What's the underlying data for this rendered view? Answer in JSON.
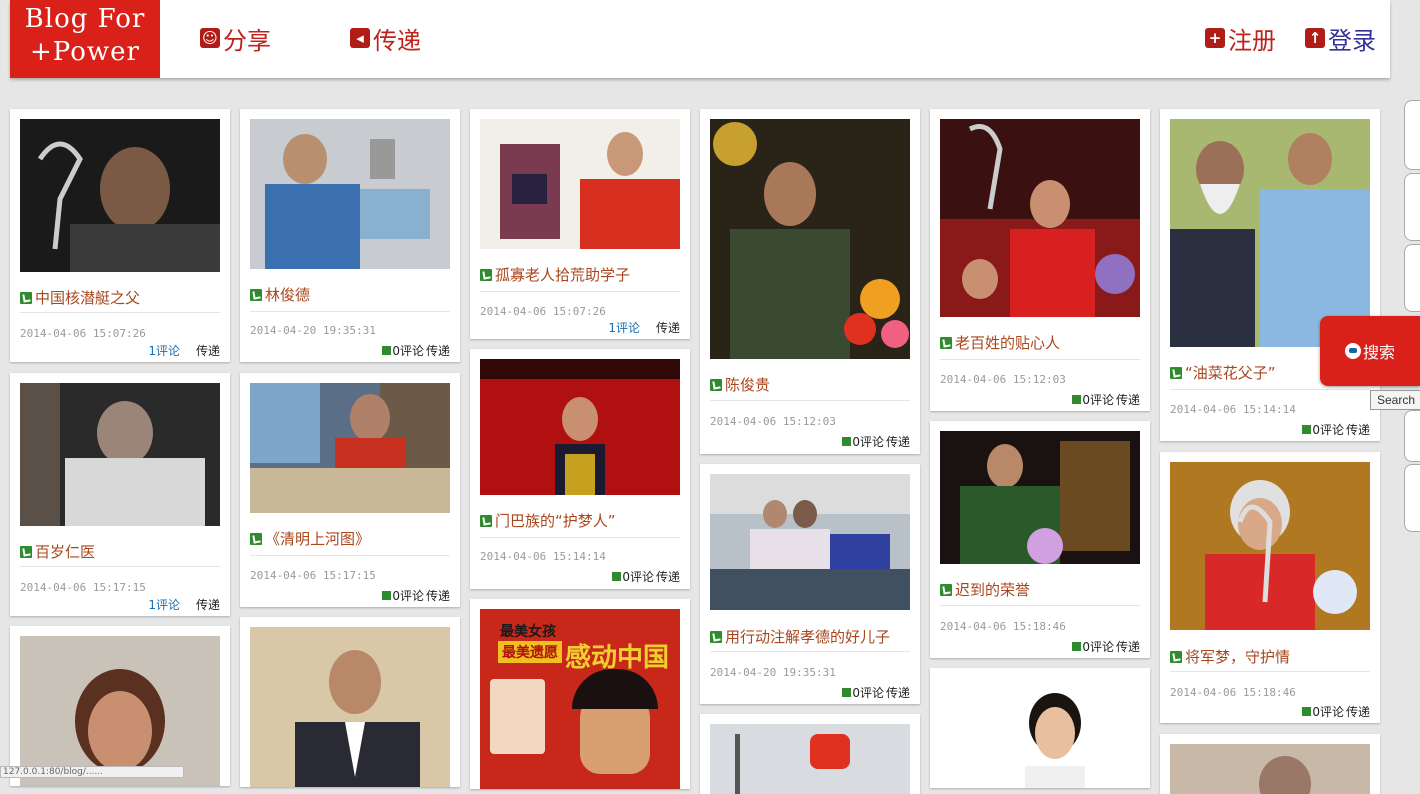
{
  "header": {
    "logo": "Blog For\n+Power",
    "nav_share": "分享",
    "nav_pass": "传递",
    "nav_register": "注册",
    "nav_login": "登录"
  },
  "cards": [
    {
      "title": "中国核潜艇之父",
      "date": "2014-04-06 15:07:26",
      "comments": "1评论",
      "pass": "传递"
    },
    {
      "title": "百岁仁医",
      "date": "2014-04-06 15:17:15",
      "comments": "1评论",
      "pass": "传递"
    },
    {
      "title": "林俊德",
      "date": "2014-04-20 19:35:31",
      "comments": "0评论",
      "pass": "传递"
    },
    {
      "title": "《清明上河图》",
      "date": "2014-04-06 15:17:15",
      "comments": "0评论",
      "pass": "传递"
    },
    {
      "title": "孤寡老人拾荒助学子",
      "date": "2014-04-06 15:07:26",
      "comments": "1评论",
      "pass": "传递"
    },
    {
      "title": "门巴族的“护梦人”",
      "date": "2014-04-06 15:14:14",
      "comments": "0评论",
      "pass": "传递"
    },
    {
      "title": "陈俊贵",
      "date": "2014-04-06 15:12:03",
      "comments": "0评论",
      "pass": "传递"
    },
    {
      "title": "用行动注解孝德的好儿子",
      "date": "2014-04-20 19:35:31",
      "comments": "0评论",
      "pass": "传递"
    },
    {
      "title": "老百姓的贴心人",
      "date": "2014-04-06 15:12:03",
      "comments": "0评论",
      "pass": "传递"
    },
    {
      "title": "迟到的荣誉",
      "date": "2014-04-06 15:18:46",
      "comments": "0评论",
      "pass": "传递"
    },
    {
      "title": "“油菜花父子”",
      "date": "2014-04-06 15:14:14",
      "comments": "0评论",
      "pass": "传递"
    },
    {
      "title": "将军梦，守护情",
      "date": "2014-04-06 15:18:46",
      "comments": "0评论",
      "pass": "传递"
    }
  ],
  "poster": {
    "line1": "最美女孩",
    "line2": "最美遗愿",
    "line3": "感动中国"
  },
  "search": {
    "label": "搜索",
    "tooltip": "Search"
  },
  "status_bar": "127.0.0.1:80/blog/......"
}
